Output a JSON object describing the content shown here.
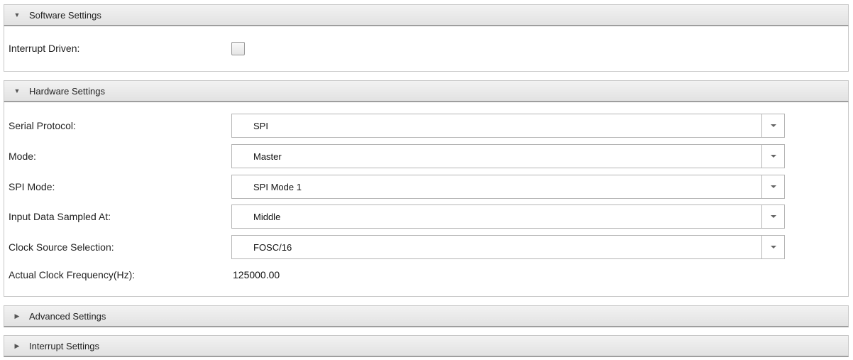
{
  "sections": {
    "software": {
      "title": "Software Settings",
      "interrupt_driven": {
        "label": "Interrupt Driven:",
        "checked": false
      }
    },
    "hardware": {
      "title": "Hardware Settings",
      "serial_protocol": {
        "label": "Serial Protocol:",
        "value": "SPI"
      },
      "mode": {
        "label": "Mode:",
        "value": "Master"
      },
      "spi_mode": {
        "label": "SPI Mode:",
        "value": "SPI Mode 1"
      },
      "input_sampled": {
        "label": "Input Data Sampled At:",
        "value": "Middle"
      },
      "clock_source": {
        "label": "Clock Source Selection:",
        "value": "FOSC/16"
      },
      "clock_freq": {
        "label": "Actual Clock Frequency(Hz):",
        "value": "125000.00"
      }
    },
    "advanced": {
      "title": "Advanced Settings"
    },
    "interrupt": {
      "title": "Interrupt Settings"
    }
  },
  "icons": {
    "expanded": "triangle-down-icon",
    "collapsed": "triangle-right-icon",
    "dropdown": "chevron-down-icon"
  }
}
